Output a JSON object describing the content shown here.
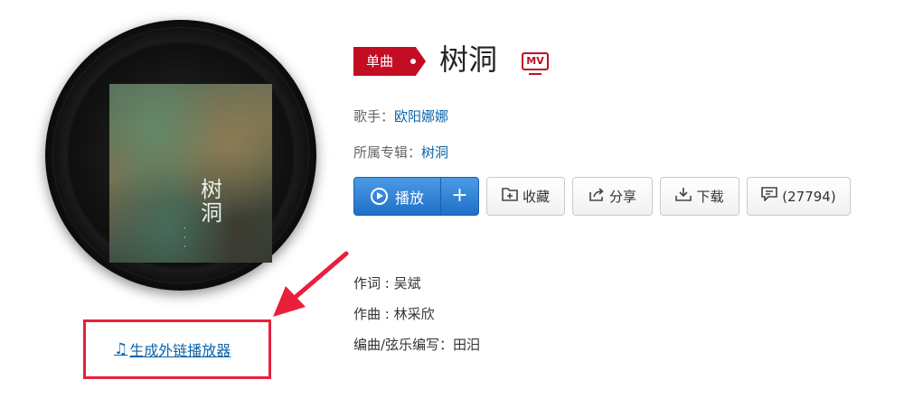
{
  "song": {
    "badge": "单曲",
    "title": "树洞",
    "mv_label": "MV"
  },
  "meta": {
    "singer_label": "歌手：",
    "singer": "欧阳娜娜",
    "album_label": "所属专辑：",
    "album": "树洞"
  },
  "cover": {
    "title_text": "树洞"
  },
  "actions": {
    "play_label": "播放",
    "add_label": "+",
    "collect_label": "收藏",
    "share_label": "分享",
    "download_label": "下载",
    "comment_count": "(27794)"
  },
  "credits": {
    "lyricist": "作词 : 吴斌",
    "composer": "作曲 : 林采欣",
    "arranger": "编曲/弦乐编写：田汨"
  },
  "player_link": {
    "label": "生成外链播放器"
  },
  "colors": {
    "brand_red": "#c30d23",
    "link_blue": "#0c63a8",
    "play_blue": "#1f6fc8",
    "annotation_red": "#e8203b"
  },
  "icons": [
    "play-circle-icon",
    "plus-icon",
    "collect-icon",
    "share-icon",
    "download-icon",
    "comment-icon",
    "music-note-icon",
    "mv-icon"
  ]
}
